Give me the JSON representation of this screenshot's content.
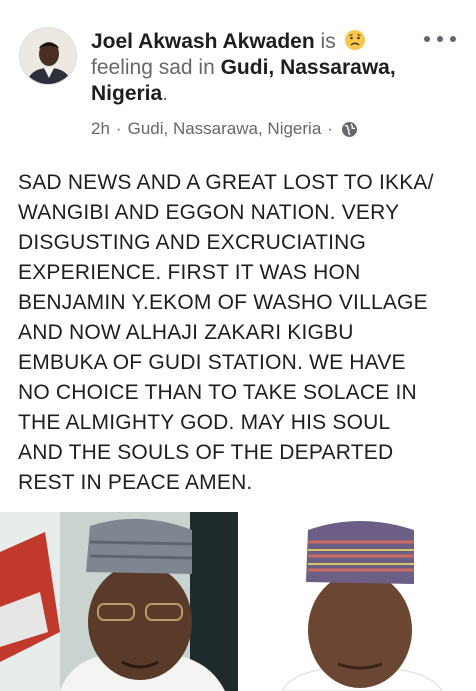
{
  "post": {
    "author_name": "Joel Akwash Akwaden",
    "is_text": " is ",
    "feeling_text": "feeling sad in ",
    "place": "Gudi, Nassarawa, Nigeria",
    "period": ".",
    "time": "2h",
    "meta_location": "Gudi, Nassarawa, Nigeria",
    "sep": "·",
    "body": "SAD NEWS AND A GREAT LOST TO IKKA/\nWANGIBI AND EGGON NATION. VERY\nDISGUSTING AND EXCRUCIATING\nEXPERIENCE. FIRST IT WAS HON\nBENJAMIN Y.EKOM OF WASHO VILLAGE\nAND NOW ALHAJI ZAKARI KIGBU\nEMBUKA OF GUDI STATION. WE HAVE\nNO CHOICE THAN TO TAKE SOLACE IN\nTHE ALMIGHTY GOD. MAY HIS SOUL\nAND THE SOULS OF THE DEPARTED\nREST IN PEACE AMEN."
  },
  "icons": {
    "feeling": "sad-face-emoji",
    "audience": "globe-icon",
    "menu": "more-options-icon"
  },
  "colors": {
    "text": "#1c1e21",
    "muted": "#65676b",
    "emoji": "#f7c84a"
  }
}
